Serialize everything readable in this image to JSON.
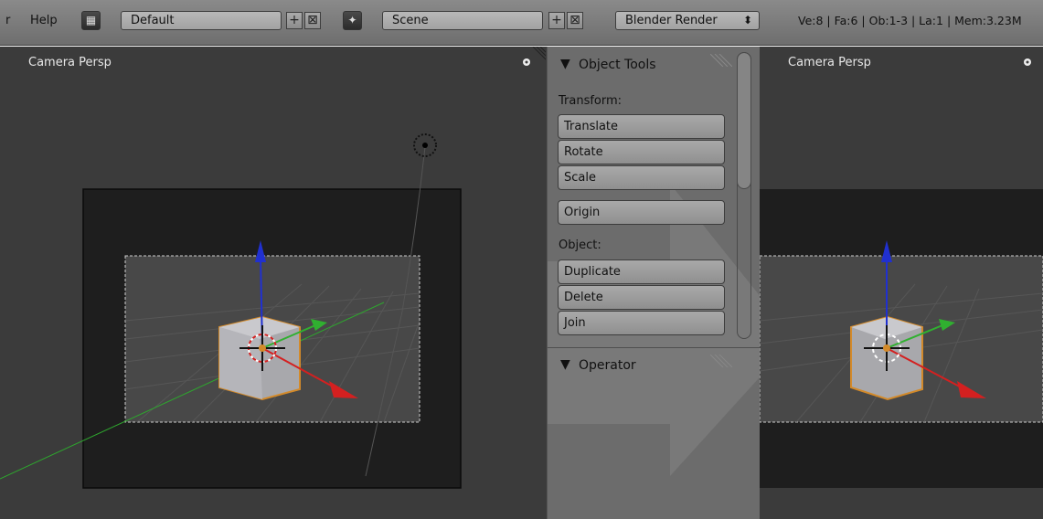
{
  "menu": {
    "partial": "r",
    "help": "Help"
  },
  "screen_layout": {
    "value": "Default",
    "add": "+",
    "remove": "⊠"
  },
  "scene_field": {
    "value": "Scene",
    "add": "+",
    "remove": "⊠"
  },
  "render_engine": {
    "value": "Blender Render",
    "arrows": "⬍"
  },
  "stats": "Ve:8 | Fa:6 | Ob:1-3 | La:1 | Mem:3.23M",
  "left_viewport": {
    "label": "Camera Persp"
  },
  "right_viewport": {
    "label": "Camera Persp"
  },
  "tools": {
    "object_tools_title": "Object Tools",
    "transform_label": "Transform:",
    "translate": "Translate",
    "rotate": "Rotate",
    "scale": "Scale",
    "origin": "Origin",
    "object_label": "Object:",
    "duplicate": "Duplicate",
    "delete": "Delete",
    "join": "Join",
    "operator_title": "Operator"
  },
  "colors": {
    "accent_orange": "#d38a2a",
    "axis_red": "#d42020",
    "axis_green": "#30b030",
    "axis_blue": "#2030d0"
  }
}
